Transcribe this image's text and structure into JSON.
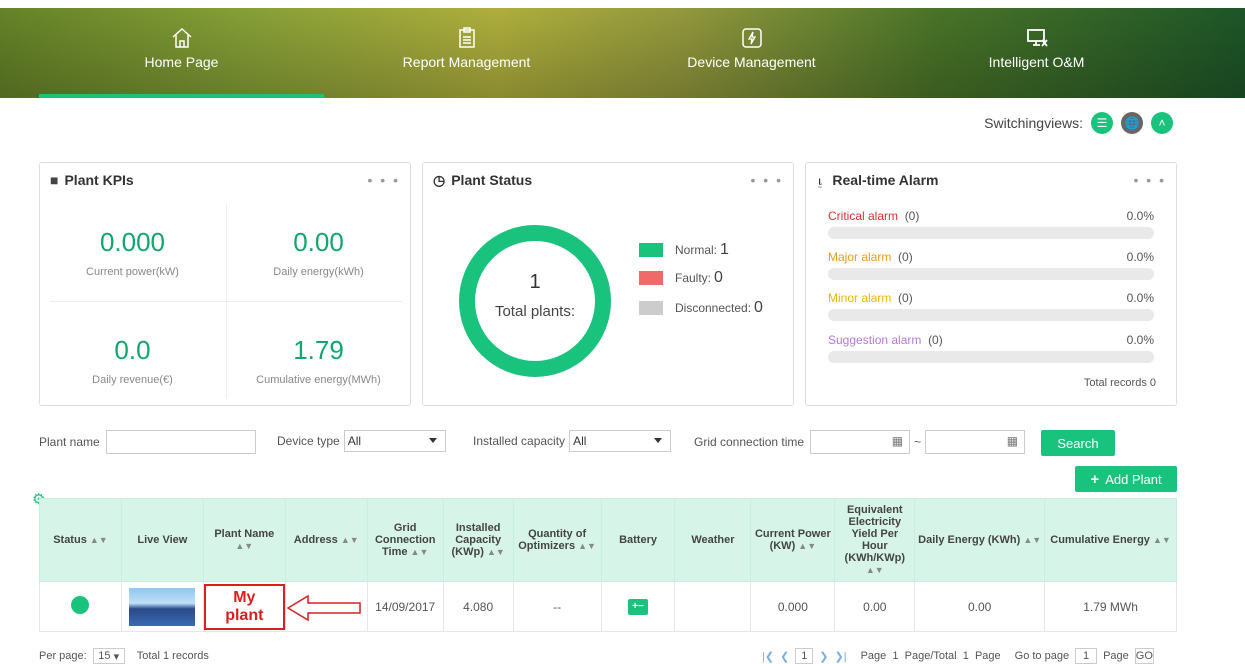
{
  "nav": {
    "items": [
      {
        "label": "Home Page",
        "icon": "home-icon"
      },
      {
        "label": "Report Management",
        "icon": "report-icon"
      },
      {
        "label": "Device Management",
        "icon": "device-icon"
      },
      {
        "label": "Intelligent O&M",
        "icon": "maintenance-icon"
      }
    ],
    "active": "Home Page"
  },
  "switch_views": {
    "label": "Switchingviews:"
  },
  "kpis": {
    "title": "Plant KPIs",
    "current_power": {
      "value": "0.000",
      "label": "Current power(kW)"
    },
    "daily_energy": {
      "value": "0.00",
      "label": "Daily energy(kWh)"
    },
    "daily_revenue": {
      "value": "0.0",
      "label": "Daily revenue(€)"
    },
    "cumulative_energy": {
      "value": "1.79",
      "label": "Cumulative energy(MWh)"
    }
  },
  "plant_status": {
    "title": "Plant Status",
    "total": "1",
    "total_label": "Total plants:",
    "legend": [
      {
        "label": "Normal:",
        "value": "1",
        "color": "#19c37d"
      },
      {
        "label": "Faulty:",
        "value": "0",
        "color": "#f06a6a"
      },
      {
        "label": "Disconnected:",
        "value": "0",
        "color": "#cccccc"
      }
    ]
  },
  "alarm": {
    "title": "Real-time Alarm",
    "rows": [
      {
        "label": "Critical alarm",
        "count": "(0)",
        "pct": "0.0%",
        "color": "#e03030"
      },
      {
        "label": "Major alarm",
        "count": "(0)",
        "pct": "0.0%",
        "color": "#f09a1a"
      },
      {
        "label": "Minor alarm",
        "count": "(0)",
        "pct": "0.0%",
        "color": "#e6b800"
      },
      {
        "label": "Suggestion alarm",
        "count": "(0)",
        "pct": "0.0%",
        "color": "#b27bd6"
      }
    ],
    "total": "Total records 0"
  },
  "filters": {
    "plant_name": "Plant name",
    "device_type": "Device type",
    "device_type_value": "All",
    "installed_capacity": "Installed capacity",
    "installed_capacity_value": "All",
    "grid_time": "Grid connection time",
    "range_sep": "~",
    "search": "Search",
    "add_plant": "Add Plant"
  },
  "table": {
    "headers": {
      "status": "Status",
      "live_view": "Live View",
      "plant_name": "Plant Name",
      "address": "Address",
      "grid_time": "Grid Connection Time",
      "capacity": "Installed Capacity (KWp)",
      "optimizers": "Quantity of Optimizers",
      "battery": "Battery",
      "weather": "Weather",
      "current_power": "Current Power (KW)",
      "yield": "Equivalent Electricity Yield Per Hour (KWh/KWp)",
      "daily_energy": "Daily Energy (KWh)",
      "cumulative_energy": "Cumulative Energy"
    },
    "row": {
      "plant_name": "My plant",
      "grid_time": "14/09/2017",
      "capacity": "4.080",
      "optimizers": "--",
      "current_power": "0.000",
      "yield": "0.00",
      "daily_energy": "0.00",
      "cumulative_energy": "1.79 MWh"
    }
  },
  "pager": {
    "per_page_label": "Per page:",
    "per_page_value": "15",
    "total": "Total 1 records",
    "current": "1",
    "page_info": "Page  1  Page/Total  1  Page",
    "goto_label": "Go to page",
    "goto_value": "1",
    "page_word": "Page",
    "go": "GO"
  },
  "colors": {
    "accent": "#19c37d",
    "accent_light": "#d6f5e8",
    "annotation": "#d92020"
  }
}
